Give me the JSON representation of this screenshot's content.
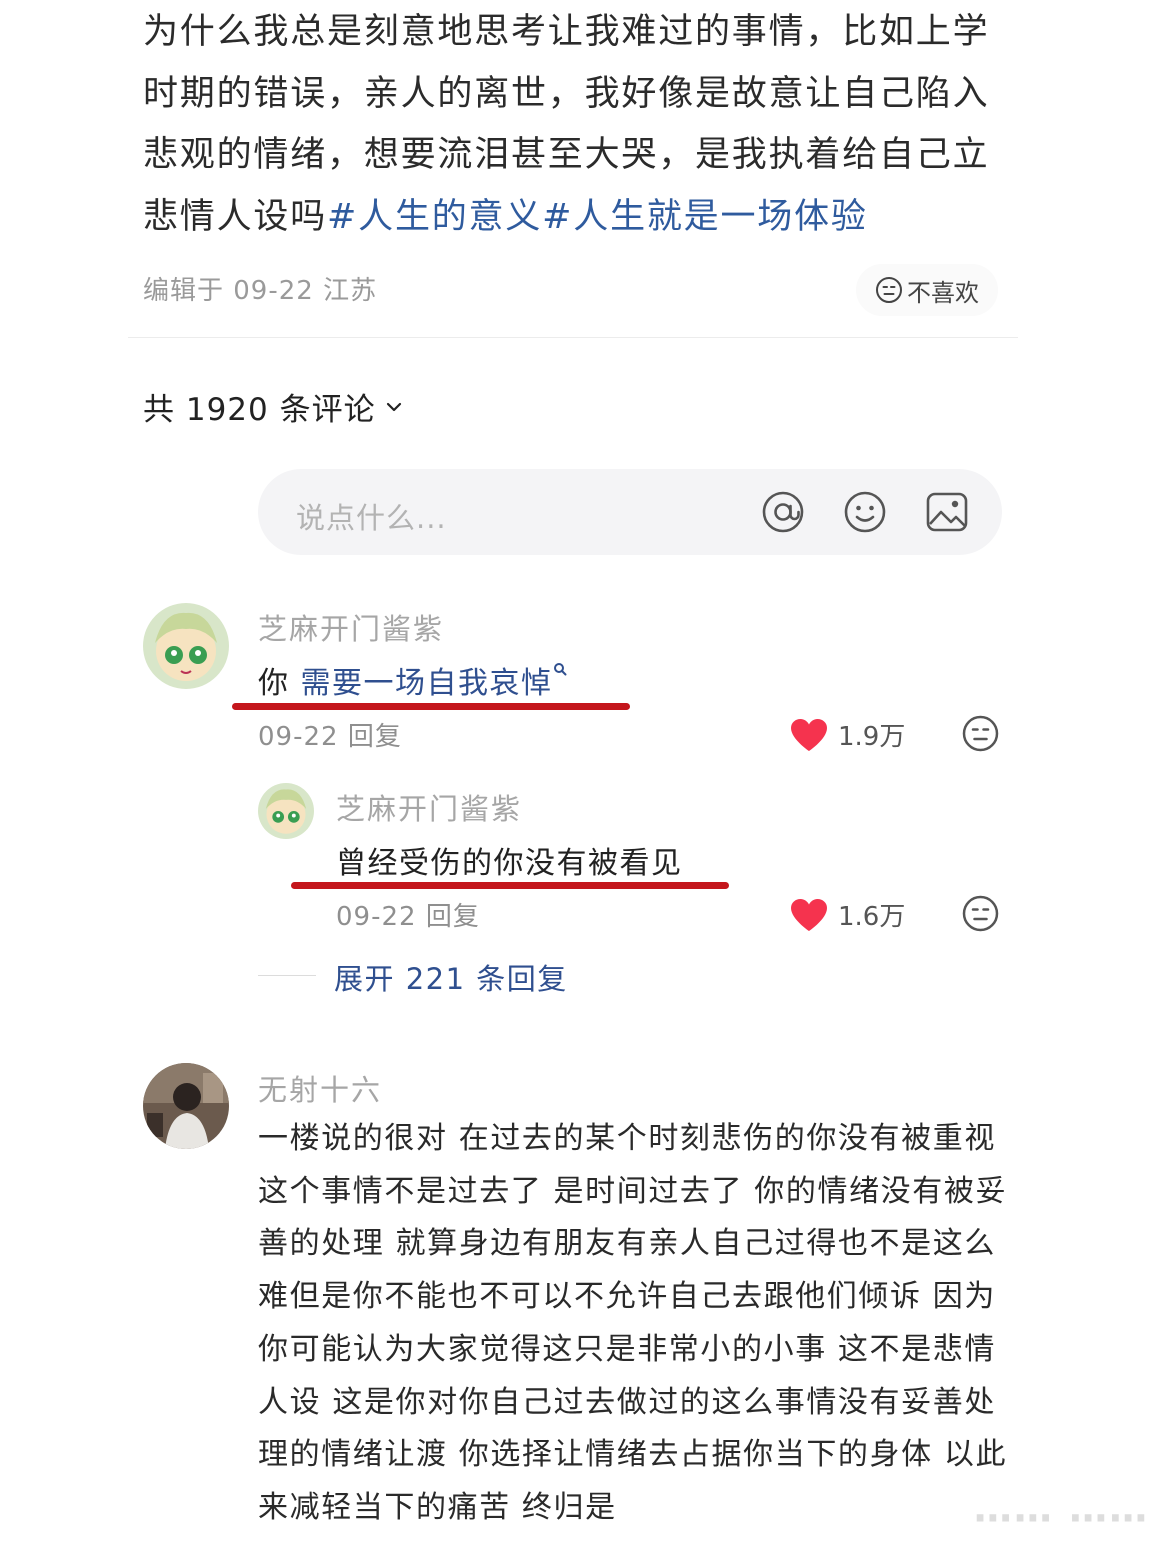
{
  "post": {
    "text": "为什么我总是刻意地思考让我难过的事情，比如上学时期的错误，亲人的离世，我好像是故意让自己陷入悲观的情绪，想要流泪甚至大哭，是我执着给自己立悲情人设吗",
    "tags": [
      "#人生的意义",
      "#人生就是一场体验"
    ],
    "meta": "编辑于 09-22 江苏",
    "dislike_label": "不喜欢"
  },
  "comments_header": {
    "count_label": "共 1920 条评论"
  },
  "comment_input": {
    "placeholder": "说点什么..."
  },
  "comments": [
    {
      "user": "芝麻开门酱紫",
      "prefix": "你",
      "link_text": "需要一场自我哀悼",
      "time_reply": "09-22 回复",
      "likes": "1.9万",
      "reply": {
        "user": "芝麻开门酱紫",
        "text": "曾经受伤的你没有被看见",
        "time_reply": "09-22 回复",
        "likes": "1.6万"
      },
      "expand_label": "展开 221 条回复"
    },
    {
      "user": "无射十六",
      "text": "一楼说的很对 在过去的某个时刻悲伤的你没有被重视 这个事情不是过去了 是时间过去了 你的情绪没有被妥善的处理 就算身边有朋友有亲人自己过得也不是这么难但是你不能也不可以不允许自己去跟他们倾诉 因为你可能认为大家觉得这只是非常小的小事 这不是悲情人设 这是你对你自己过去做过的这么事情没有妥善处理的情绪让渡 你选择让情绪去占据你当下的身体 以此来减轻当下的痛苦 终归是"
    }
  ],
  "colors": {
    "accent_link": "#2f4f8f",
    "heart": "#f5334e",
    "underline_red": "#c4161c"
  }
}
